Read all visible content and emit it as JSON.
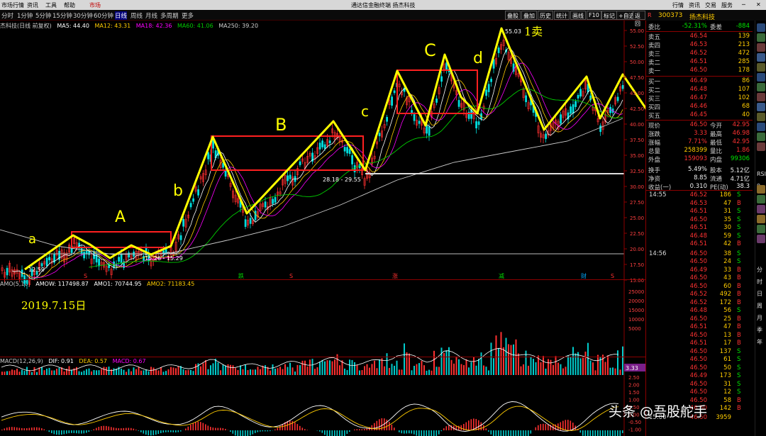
{
  "menubar": {
    "items": [
      "市场行情",
      "资讯",
      "工具",
      "帮助",
      "市场"
    ],
    "window_title": "通达信金融终端  扬杰科技",
    "right_items": [
      "行情",
      "资讯",
      "交易",
      "服务"
    ]
  },
  "toolbar": {
    "periods": [
      "分时",
      "1分钟",
      "5分钟",
      "15分钟",
      "30分钟",
      "60分钟",
      "日线",
      "周线",
      "月线",
      "多周期",
      "更多"
    ],
    "selected": "日线",
    "right_buttons": [
      "叠股",
      "叠加",
      "历史",
      "统计",
      "画线",
      "F10",
      "标记",
      "+自选",
      "返回"
    ]
  },
  "stock": {
    "code": "300373",
    "name": "扬杰科技",
    "right_marker": "R"
  },
  "main_indicator": {
    "name": "杰科技(日线 前复权)",
    "ma": [
      {
        "label": "MA5: 44.40",
        "color": "#ffffff"
      },
      {
        "label": "MA12: 43.31",
        "color": "#ffcc00"
      },
      {
        "label": "MA18: 42.36",
        "color": "#ff00ff"
      },
      {
        "label": "MA60: 41.06",
        "color": "#00cc00"
      },
      {
        "label": "MA250: 39.20",
        "color": "#cccccc"
      }
    ]
  },
  "vol_indicator": {
    "name": "AMO(5,10)",
    "items": [
      "AMOW: 117498.87",
      "AMO1: 70744.95",
      "AMO2: 71183.45"
    ]
  },
  "macd_indicator": {
    "name": "MACD(12,26,9)",
    "items": [
      "DIF: 0.91",
      "DEA: 0.57",
      "MACD: 0.67"
    ]
  },
  "price_axis": [
    "55.00",
    "52.50",
    "50.00",
    "47.50",
    "45.00",
    "42.50",
    "40.00",
    "37.50",
    "35.00",
    "32.50",
    "30.00",
    "27.50",
    "25.00",
    "22.50",
    "20.00",
    "17.50",
    "15.00"
  ],
  "vol_axis": [
    "25000",
    "20000",
    "15000",
    "10000",
    "5000"
  ],
  "macd_axis": [
    "2.50",
    "2.00",
    "1.50",
    "1.00",
    "0.50",
    "0.00",
    "-0.50",
    "-1.00"
  ],
  "macd_marker": "3.33",
  "chart_labels": {
    "high_peak": "55.03",
    "sell": "1卖",
    "low_1259": "12.59",
    "range_a": "15.26 - 15.29",
    "range_b": "28.18 - 29.55",
    "date": "2019.7.15日",
    "wave_a": "a",
    "wave_A": "A",
    "wave_b": "b",
    "wave_B": "B",
    "wave_c": "c",
    "wave_C": "C",
    "wave_d": "d"
  },
  "bottom_marks": [
    "S",
    "跌",
    "S",
    "涨",
    "减",
    "财",
    "S"
  ],
  "quote": {
    "weibi": {
      "label": "委比",
      "value": "-52.31%",
      "label2": "委差",
      "value2": "-884"
    },
    "asks": [
      {
        "l": "卖五",
        "p": "46.54",
        "v": "139"
      },
      {
        "l": "卖四",
        "p": "46.53",
        "v": "213"
      },
      {
        "l": "卖三",
        "p": "46.52",
        "v": "472"
      },
      {
        "l": "卖二",
        "p": "46.51",
        "v": "285"
      },
      {
        "l": "卖一",
        "p": "46.50",
        "v": "178"
      }
    ],
    "bids": [
      {
        "l": "买一",
        "p": "46.49",
        "v": "86"
      },
      {
        "l": "买二",
        "p": "46.48",
        "v": "107"
      },
      {
        "l": "买三",
        "p": "46.47",
        "v": "102"
      },
      {
        "l": "买四",
        "p": "46.46",
        "v": "68"
      },
      {
        "l": "买五",
        "p": "46.45",
        "v": "40"
      }
    ],
    "stats": [
      {
        "a": "现价",
        "av": "46.50",
        "ac": "red",
        "b": "今开",
        "bv": "42.95",
        "bc": "red"
      },
      {
        "a": "涨跌",
        "av": "3.33",
        "ac": "red",
        "b": "最高",
        "bv": "46.98",
        "bc": "red"
      },
      {
        "a": "涨幅",
        "av": "7.71%",
        "ac": "red",
        "b": "最低",
        "bv": "42.95",
        "bc": "red"
      },
      {
        "a": "总量",
        "av": "258399",
        "ac": "yel",
        "b": "量比",
        "bv": "1.86",
        "bc": "red"
      },
      {
        "a": "外盘",
        "av": "159093",
        "ac": "red",
        "b": "内盘",
        "bv": "99306",
        "bc": "grn"
      },
      {
        "a": "换手",
        "av": "5.49%",
        "ac": "wht",
        "b": "股本",
        "bv": "5.12亿",
        "bc": "wht"
      },
      {
        "a": "净资",
        "av": "8.85",
        "ac": "wht",
        "b": "流通",
        "bv": "4.71亿",
        "bc": "wht"
      },
      {
        "a": "收益(一)",
        "av": "0.310",
        "ac": "wht",
        "b": "PE(动)",
        "bv": "38.3",
        "bc": "wht"
      }
    ],
    "ticks": [
      {
        "t": "14:55",
        "p": "46.52",
        "v": "186",
        "s": "S"
      },
      {
        "t": "",
        "p": "46.53",
        "v": "47",
        "s": "B"
      },
      {
        "t": "",
        "p": "46.51",
        "v": "31",
        "s": "S"
      },
      {
        "t": "",
        "p": "46.50",
        "v": "35",
        "s": "S"
      },
      {
        "t": "",
        "p": "46.51",
        "v": "30",
        "s": "S"
      },
      {
        "t": "",
        "p": "46.48",
        "v": "59",
        "s": "S"
      },
      {
        "t": "",
        "p": "46.51",
        "v": "42",
        "s": "B"
      },
      {
        "t": "14:56",
        "p": "46.50",
        "v": "38",
        "s": "S"
      },
      {
        "t": "",
        "p": "46.50",
        "v": "24",
        "s": "S"
      },
      {
        "t": "",
        "p": "46.49",
        "v": "33",
        "s": "B"
      },
      {
        "t": "",
        "p": "46.50",
        "v": "43",
        "s": "B"
      },
      {
        "t": "",
        "p": "46.50",
        "v": "60",
        "s": "B"
      },
      {
        "t": "",
        "p": "46.52",
        "v": "492",
        "s": "B"
      },
      {
        "t": "",
        "p": "46.52",
        "v": "172",
        "s": "B"
      },
      {
        "t": "",
        "p": "46.48",
        "v": "56",
        "s": "S"
      },
      {
        "t": "",
        "p": "46.50",
        "v": "25",
        "s": "B"
      },
      {
        "t": "",
        "p": "46.51",
        "v": "47",
        "s": "B"
      },
      {
        "t": "",
        "p": "46.50",
        "v": "13",
        "s": "B"
      },
      {
        "t": "",
        "p": "46.51",
        "v": "17",
        "s": "B"
      },
      {
        "t": "",
        "p": "46.50",
        "v": "137",
        "s": "S"
      },
      {
        "t": "",
        "p": "46.50",
        "v": "61",
        "s": "S"
      },
      {
        "t": "",
        "p": "46.50",
        "v": "50",
        "s": "S"
      },
      {
        "t": "",
        "p": "46.49",
        "v": "173",
        "s": "S"
      },
      {
        "t": "",
        "p": "46.50",
        "v": "31",
        "s": "S"
      },
      {
        "t": "",
        "p": "46.50",
        "v": "12",
        "s": "S"
      },
      {
        "t": "",
        "p": "46.50",
        "v": "58",
        "s": "B"
      },
      {
        "t": "",
        "p": "46.50",
        "v": "142",
        "s": "B"
      },
      {
        "t": "15:00",
        "p": "46.50",
        "v": "3959",
        "s": ""
      }
    ]
  },
  "sidebar_text": [
    "RSI",
    "9",
    "分",
    "时",
    "日",
    "周",
    "月",
    "季",
    "年"
  ],
  "watermark": "头条 @吾股舵手"
}
